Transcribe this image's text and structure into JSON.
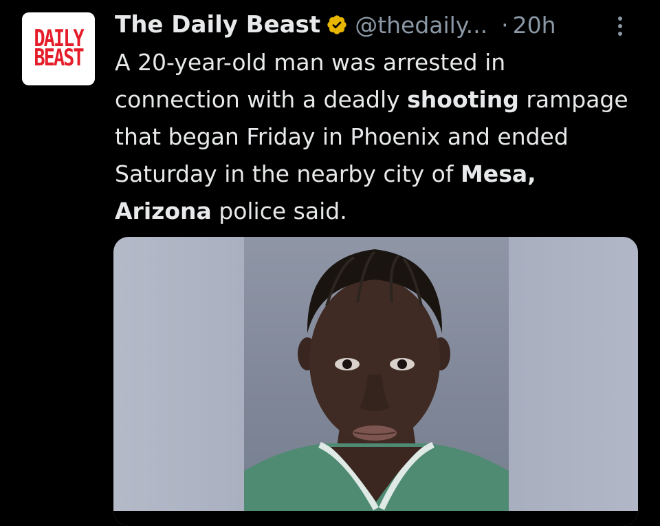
{
  "avatar": {
    "logo_line1": "DAILY",
    "logo_line2": "BEAST",
    "logo_color": "#e51d2a"
  },
  "author": {
    "name": "The Daily Beast",
    "verified_icon": "verified-badge-icon",
    "badge_color": "#e8b500",
    "handle": "@thedaily...",
    "separator": "·",
    "time": "20h"
  },
  "menu": {
    "icon": "more-vertical-icon"
  },
  "tweet": {
    "part1": "A 20-year-old man was arrested in connection with a deadly ",
    "bold1": "shooting",
    "part2": " rampage that began Friday in Phoenix and ended Saturday in the nearby city of ",
    "bold2": "Mesa, Arizona",
    "part3": " police said."
  },
  "media": {
    "type": "photo",
    "subject": "mugshot"
  },
  "colors": {
    "background": "#000000",
    "text": "#e7e9ea",
    "secondary": "#8b98a5"
  }
}
